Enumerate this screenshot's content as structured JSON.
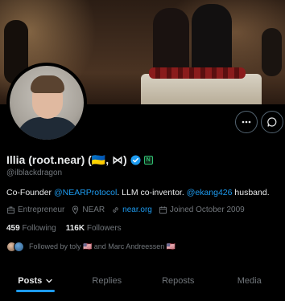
{
  "profile": {
    "name": "Illia (root.near) (🇺🇦, ⋈)",
    "affiliate_badge": "N",
    "handle": "@ilblackdragon",
    "bio": {
      "prefix": "Co-Founder ",
      "mention1": "@NEARProtocol",
      "middle": ". LLM co-inventor. ",
      "mention2": "@ekang426",
      "suffix": " husband."
    },
    "meta": {
      "category": "Entrepreneur",
      "location": "NEAR",
      "website": "near.org",
      "joined": "Joined October 2009"
    },
    "following_count": "459",
    "following_label": "Following",
    "followers_count": "116K",
    "followers_label": "Followers",
    "followed_by": "Followed by toly 🇺🇸 and Marc Andreessen 🇺🇸"
  },
  "tabs": [
    {
      "label": "Posts"
    },
    {
      "label": "Replies"
    },
    {
      "label": "Reposts"
    },
    {
      "label": "Media"
    }
  ],
  "colors": {
    "accent": "#1d9bf0",
    "muted": "#71767b",
    "text": "#e7e9ea",
    "background": "#000000"
  },
  "icons": [
    "more-icon",
    "message-icon",
    "verified-icon",
    "briefcase-icon",
    "location-icon",
    "link-icon",
    "calendar-icon",
    "chevron-down-icon"
  ]
}
